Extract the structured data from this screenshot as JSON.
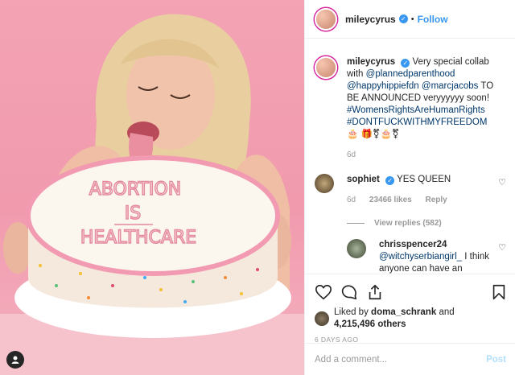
{
  "header": {
    "username": "mileycyrus",
    "dot": "•",
    "follow_label": "Follow"
  },
  "caption": {
    "username": "mileycyrus",
    "text_1": "Very special collab with",
    "mention_1": "@plannedparenthood",
    "mention_2": "@happyhippiefdn",
    "mention_3": "@marcjacobs",
    "text_2": "TO BE ANNOUNCED veryyyyyy soon!",
    "hashtag_1": "#WomensRightsAreHumanRights",
    "hashtag_2": "#DONTFUCKWITHMYFREEDOM",
    "emoji_1": "🎂",
    "emoji_2": "🎁⚧🎂⚧",
    "age": "6d"
  },
  "comments": [
    {
      "username": "sophiet",
      "text": "YES QUEEN",
      "age": "6d",
      "likes": "23466 likes",
      "reply_label": "Reply",
      "view_replies": "View replies (582)"
    },
    {
      "username": "chrisspencer24",
      "mention": "@witchyserbiangirl_",
      "text": "I think anyone can have an"
    }
  ],
  "likes": {
    "prefix": "Liked by",
    "user": "doma_schrank",
    "and": "and",
    "count": "4,215,496 others"
  },
  "date": "6 DAYS AGO",
  "add_comment": {
    "placeholder": "Add a comment...",
    "post_label": "Post"
  },
  "image": {
    "cake_text_1": "ABORTION",
    "cake_text_2": "IS",
    "cake_text_3": "HEALTHCARE"
  },
  "colors": {
    "accent": "#3897f0",
    "background_pink": "#f19aae",
    "link": "#00376b"
  },
  "icons": [
    "verified-icon",
    "heart-icon",
    "comment-icon",
    "share-icon",
    "bookmark-icon",
    "user-tag-icon"
  ]
}
